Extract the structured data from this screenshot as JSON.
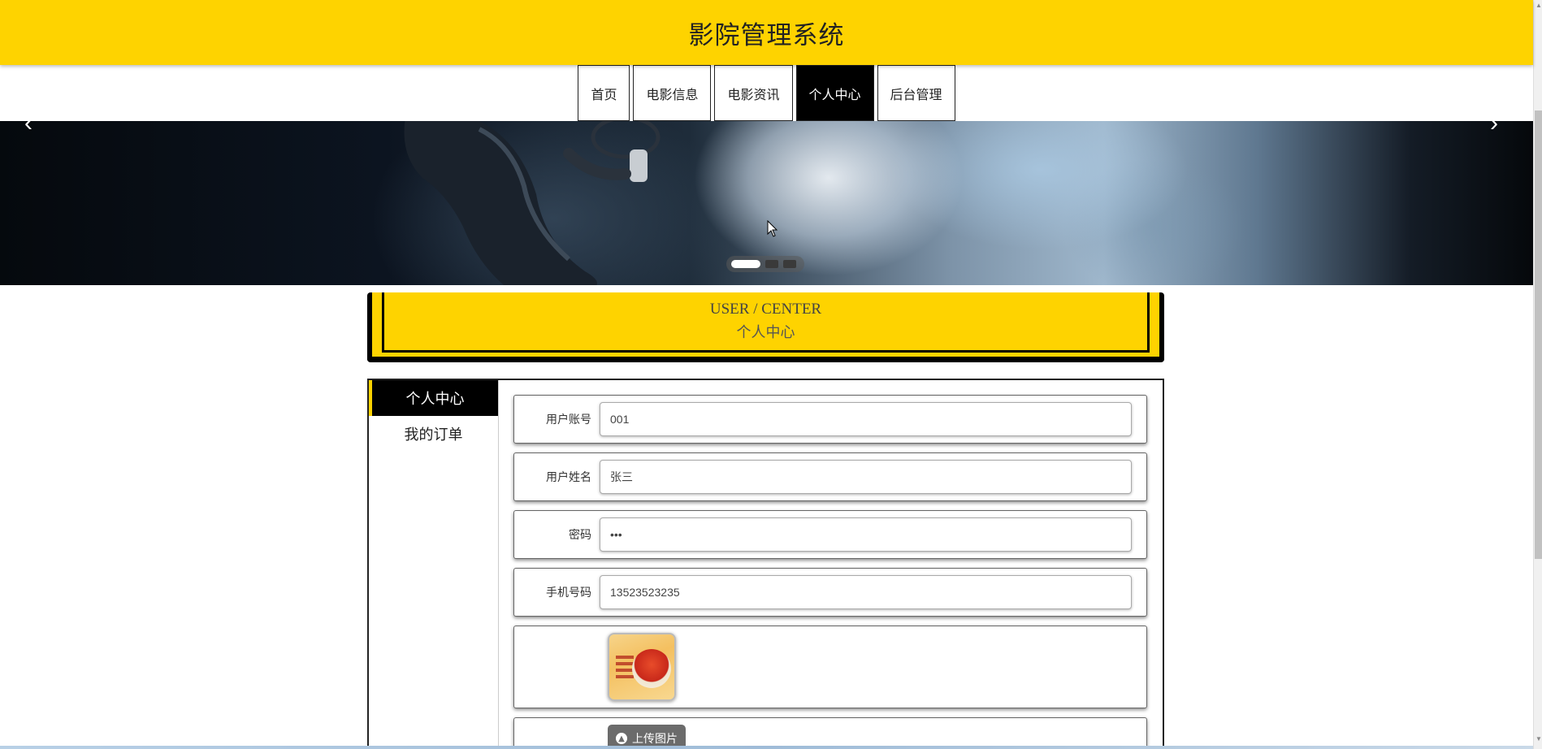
{
  "header": {
    "title": "影院管理系统"
  },
  "nav": {
    "items": [
      {
        "label": "首页"
      },
      {
        "label": "电影信息"
      },
      {
        "label": "电影资讯"
      },
      {
        "label": "个人中心",
        "active": true
      },
      {
        "label": "后台管理"
      }
    ]
  },
  "banner": {
    "prev_icon": "‹",
    "next_icon": "›",
    "slide_count": 3,
    "active_slide": 1
  },
  "section": {
    "title_en": "USER / CENTER",
    "title_cn": "个人中心"
  },
  "sidebar": {
    "items": [
      {
        "label": "个人中心",
        "active": true
      },
      {
        "label": "我的订单"
      }
    ]
  },
  "form": {
    "account_label": "用户账号",
    "account_value": "001",
    "name_label": "用户姓名",
    "name_value": "张三",
    "password_label": "密码",
    "password_value": "•••",
    "phone_label": "手机号码",
    "phone_value": "13523523235",
    "upload_label": "上传图片"
  },
  "colors": {
    "accent": "#FED300",
    "dark": "#000000"
  }
}
